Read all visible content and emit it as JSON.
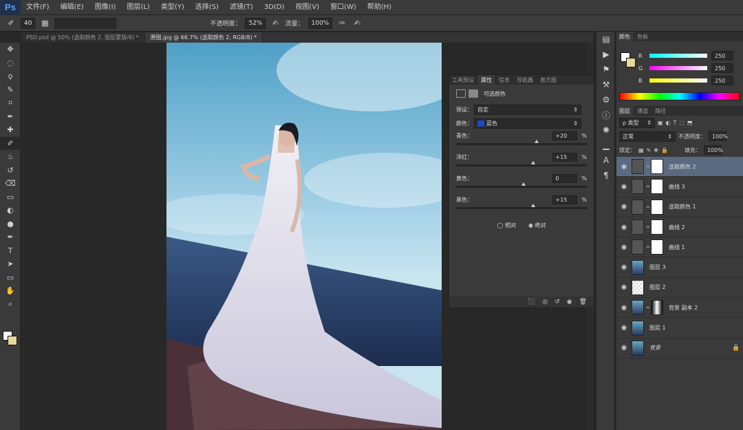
{
  "app": {
    "logo": "Ps"
  },
  "menu": [
    "文件(F)",
    "编辑(E)",
    "图像(I)",
    "图层(L)",
    "类型(Y)",
    "选择(S)",
    "滤镜(T)",
    "3D(D)",
    "视图(V)",
    "窗口(W)",
    "帮助(H)"
  ],
  "options": {
    "brush_size": "40",
    "zoom": "52%",
    "opacity_label": "不透明度：",
    "flow_label": "流量：",
    "flow": "100%"
  },
  "tabs": [
    {
      "label": "PSD.psd @ 50% (选取颜色 2, 图层蒙版/8) *",
      "active": false
    },
    {
      "label": "原图.jpg @ 66.7% (选取颜色 2, RGB/8) *",
      "active": true
    }
  ],
  "tools": [
    "move-tool",
    "marquee-tool",
    "lasso-tool",
    "quick-select-tool",
    "crop-tool",
    "eyedropper-tool",
    "healing-tool",
    "brush-tool",
    "stamp-tool",
    "history-brush-tool",
    "eraser-tool",
    "gradient-tool",
    "blur-tool",
    "dodge-tool",
    "pen-tool",
    "type-tool",
    "path-select-tool",
    "shape-tool",
    "hand-tool",
    "zoom-tool"
  ],
  "tool_glyphs": [
    "✥",
    "◌",
    "ϙ",
    "✎",
    "⌗",
    "✒",
    "✚",
    "✐",
    "♨",
    "↺",
    "⌫",
    "▭",
    "◐",
    "●",
    "✒",
    "T",
    "➤",
    "▭",
    "✋",
    "⌕"
  ],
  "colors": {
    "foreground": "#ffffff",
    "background": "#e8d89a",
    "selected_layer": "#5a6a80",
    "swatch_blue": "#1a47c8"
  },
  "color_panel": {
    "tabs": [
      "颜色",
      "色板"
    ],
    "rows": [
      {
        "label": "R",
        "value": "250"
      },
      {
        "label": "G",
        "value": "250"
      },
      {
        "label": "B",
        "value": "250"
      }
    ]
  },
  "properties": {
    "tabs": [
      "工具预设",
      "属性",
      "信息",
      "导航器",
      "直方图"
    ],
    "title": "可选颜色",
    "preset_label": "预设：",
    "preset_value": "自定",
    "color_label": "颜色：",
    "color_value": "蓝色",
    "sliders": [
      {
        "label": "青色：",
        "value": "+20",
        "pct": "%",
        "pos": 0.6
      },
      {
        "label": "洋红：",
        "value": "+15",
        "pct": "%",
        "pos": 0.575
      },
      {
        "label": "黄色：",
        "value": "0",
        "pct": "%",
        "pos": 0.5
      },
      {
        "label": "黑色：",
        "value": "+15",
        "pct": "%",
        "pos": 0.575
      }
    ],
    "relative": "相对",
    "absolute": "绝对"
  },
  "layers_panel": {
    "tabs": [
      "图层",
      "通道",
      "路径"
    ],
    "filter": "ρ 类型",
    "blend": "正常",
    "opacity_label": "不透明度：",
    "opacity": "100%",
    "lock_label": "锁定：",
    "fill_label": "填充：",
    "fill": "100%",
    "layers": [
      {
        "name": "选取颜色 2",
        "type": "adjust",
        "selected": true
      },
      {
        "name": "曲线 3",
        "type": "curve",
        "selected": false
      },
      {
        "name": "选取颜色 1",
        "type": "adjust",
        "selected": false
      },
      {
        "name": "曲线 2",
        "type": "curve",
        "selected": false
      },
      {
        "name": "曲线 1",
        "type": "curve",
        "selected": false
      },
      {
        "name": "图层 3",
        "type": "image",
        "selected": false
      },
      {
        "name": "图层 2",
        "type": "empty",
        "selected": false
      },
      {
        "name": "背景 副本 2",
        "type": "masked",
        "selected": false
      },
      {
        "name": "图层 1",
        "type": "image",
        "selected": false
      },
      {
        "name": "背景",
        "type": "background",
        "selected": false
      }
    ]
  }
}
